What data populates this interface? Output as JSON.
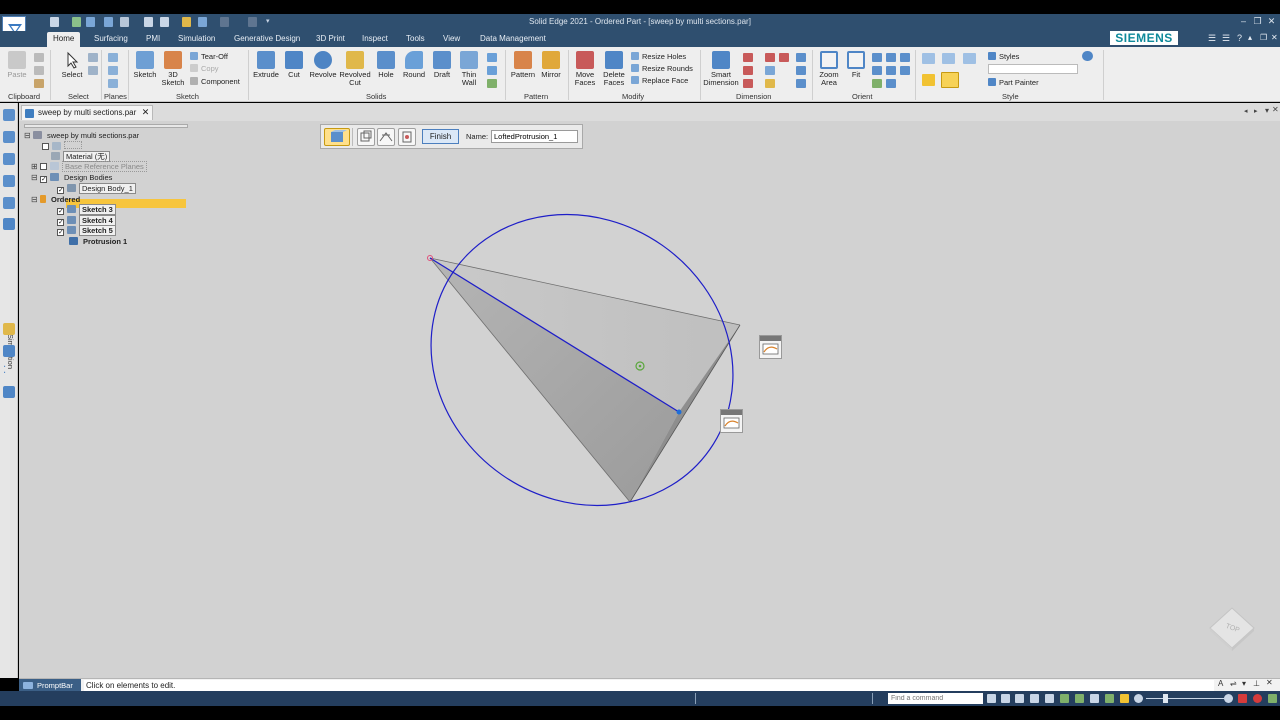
{
  "window": {
    "title": "Solid Edge 2021 - Ordered Part - [sweep by multi sections.par]"
  },
  "brand": {
    "name": "SIEMENS"
  },
  "ribbon": {
    "tabs": [
      "Home",
      "Surfacing",
      "PMI",
      "Simulation",
      "Generative Design",
      "3D Print",
      "Inspect",
      "Tools",
      "View",
      "Data Management"
    ],
    "active_tab": "Home",
    "clipboard": {
      "paste": "Paste",
      "label": "Clipboard"
    },
    "select": {
      "select": "Select",
      "label": "Select"
    },
    "planes": {
      "label": "Planes"
    },
    "sketch": {
      "sketch": "Sketch",
      "sketch3d": "3D Sketch",
      "tearoff": "Tear-Off",
      "copy": "Copy",
      "component": "Component",
      "label": "Sketch"
    },
    "solids": {
      "extrude": "Extrude",
      "cut": "Cut",
      "revolve": "Revolve",
      "revolved_cut": "Revolved Cut",
      "hole": "Hole",
      "round": "Round",
      "draft": "Draft",
      "thin_wall": "Thin Wall",
      "label": "Solids"
    },
    "pattern": {
      "pattern": "Pattern",
      "mirror": "Mirror",
      "label": "Pattern"
    },
    "modify": {
      "move_faces": "Move Faces",
      "delete_faces": "Delete Faces",
      "resize_holes": "Resize Holes",
      "resize_rounds": "Resize Rounds",
      "replace_face": "Replace Face",
      "label": "Modify"
    },
    "dimension": {
      "smart_dimension": "Smart Dimension",
      "label": "Dimension"
    },
    "orient": {
      "zoom_area": "Zoom Area",
      "fit": "Fit",
      "label": "Orient"
    },
    "style": {
      "styles": "Styles",
      "part_painter": "Part Painter",
      "label": "Style"
    }
  },
  "sidebar": {
    "simulation_label": "Simulation"
  },
  "document_tab": {
    "name": "sweep by multi sections.par"
  },
  "pathfinder": {
    "root": "sweep by multi sections.par",
    "material": "Material (无)",
    "base_reference_planes": "Base Reference Planes",
    "design_bodies": "Design Bodies",
    "design_body": "Design Body_1",
    "ordered": "Ordered",
    "sketches": [
      "Sketch 3",
      "Sketch 4",
      "Sketch 5"
    ],
    "protrusion": "Protrusion 1"
  },
  "command_bar": {
    "finish": "Finish",
    "name_label": "Name:",
    "name_value": "LoftedProtrusion_1"
  },
  "view_cube": {
    "label": "TOP"
  },
  "prompt_bar": {
    "title": "PromptBar",
    "text": "Click on elements to edit."
  },
  "status_bar": {
    "find_placeholder": "Find a command"
  },
  "colors": {
    "title_bar": "#2f4f6f",
    "ribbon": "#eeeeee",
    "graphics_background": "#d2d2d2",
    "ellipse_curve": "#1e1ec8",
    "ordered_highlight": "#f7c53d",
    "brand": "#0f8a9b"
  }
}
